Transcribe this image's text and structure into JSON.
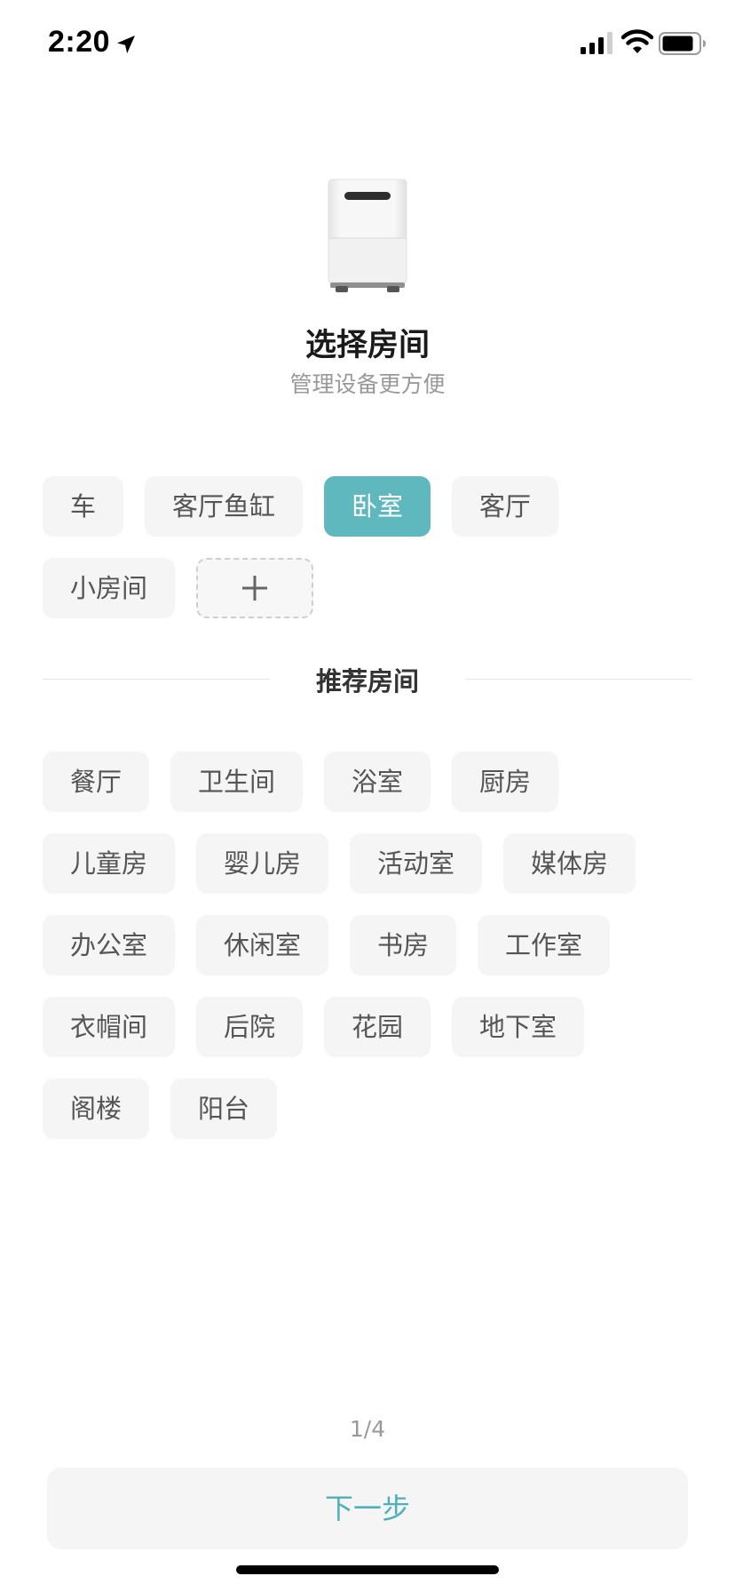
{
  "status_bar": {
    "time": "2:20"
  },
  "header": {
    "title": "选择房间",
    "subtitle": "管理设备更方便"
  },
  "my_rooms": [
    {
      "label": "车",
      "selected": false
    },
    {
      "label": "客厅鱼缸",
      "selected": false
    },
    {
      "label": "卧室",
      "selected": true
    },
    {
      "label": "客厅",
      "selected": false
    },
    {
      "label": "小房间",
      "selected": false
    }
  ],
  "recommended_title": "推荐房间",
  "recommended_rooms": [
    "餐厅",
    "卫生间",
    "浴室",
    "厨房",
    "儿童房",
    "婴儿房",
    "活动室",
    "媒体房",
    "办公室",
    "休闲室",
    "书房",
    "工作室",
    "衣帽间",
    "后院",
    "花园",
    "地下室",
    "阁楼",
    "阳台"
  ],
  "footer": {
    "page_indicator": "1/4",
    "next_label": "下一步"
  },
  "colors": {
    "accent": "#5fb8be",
    "chip_bg": "#f5f5f5",
    "next_text": "#4fb0bb"
  },
  "icons": {
    "location": "location-arrow-icon",
    "signal": "cellular-signal-icon",
    "wifi": "wifi-icon",
    "battery": "battery-icon",
    "add": "plus-icon"
  }
}
